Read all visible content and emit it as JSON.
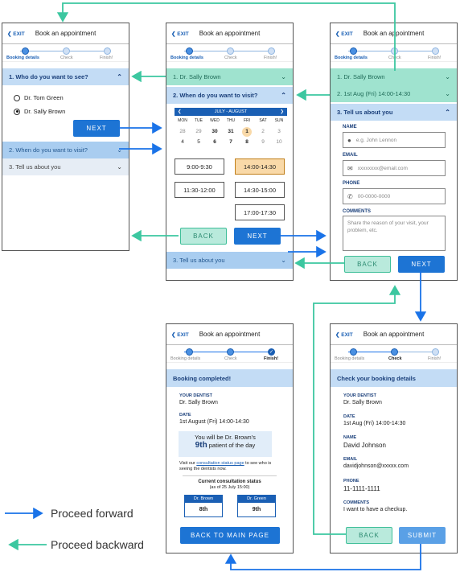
{
  "common": {
    "exit": "EXIT",
    "title": "Book an appointment",
    "steps": [
      "Booking details",
      "Check",
      "Finish!"
    ],
    "back": "BACK",
    "next": "NEXT"
  },
  "s1": {
    "q1": "1. Who do you want to see?",
    "opt1": "Dr. Tom Green",
    "opt2": "Dr. Sally Brown",
    "q2": "2. When do you want to visit?",
    "q3": "3. Tell us about you"
  },
  "s2": {
    "a1": "1. Dr. Sally Brown",
    "q2": "2. When do you want to visit?",
    "month": "JULY - AUGUST",
    "days": [
      "MON",
      "TUE",
      "WED",
      "THU",
      "FRI",
      "SAT",
      "SUN"
    ],
    "week1": [
      "28",
      "29",
      "30",
      "31",
      "1",
      "2",
      "3"
    ],
    "week2": [
      "4",
      "5",
      "6",
      "7",
      "8",
      "9",
      "10"
    ],
    "slots": [
      "9:00-9:30",
      "14:00-14:30",
      "11:30-12:00",
      "14:30-15:00",
      "17:00-17:30"
    ],
    "q3": "3. Tell us about you"
  },
  "s3": {
    "a1": "1. Dr. Sally Brown",
    "a2": "2. 1st Aug (Fri) 14:00-14:30",
    "q3": "3. Tell us about you",
    "name_lbl": "NAME",
    "name_ph": "e.g. John Lennon",
    "email_lbl": "EMAIL",
    "email_ph": "xxxxxxxx@email.com",
    "phone_lbl": "PHONE",
    "phone_ph": "00-0000-0000",
    "comments_lbl": "COMMENTS",
    "comments_ph": "Share the reason of your visit, your problem, etc."
  },
  "s4": {
    "heading": "Check your booking details",
    "dentist_lbl": "YOUR DENTIST",
    "dentist": "Dr. Sally Brown",
    "date_lbl": "DATE",
    "date": "1st Aug (Fri) 14:00-14:30",
    "name_lbl": "NAME",
    "name": "David Johnson",
    "email_lbl": "EMAIL",
    "email": "davidjohnson@xxxxx.com",
    "phone_lbl": "PHONE",
    "phone": "11-1111-1111",
    "comments_lbl": "COMMENTS",
    "comments": "I want to have a checkup.",
    "submit": "SUBMIT"
  },
  "s5": {
    "heading": "Booking completed!",
    "dentist_lbl": "YOUR DENTIST",
    "dentist": "Dr. Sally Brown",
    "date_lbl": "DATE",
    "date": "1st August (Fri) 14:00-14:30",
    "youwill": "You will be Dr. Brown's",
    "ninth": "9th",
    "patient": "patient of the day",
    "visit1": "Visit our",
    "visit_link": "consultation status page",
    "visit2": "to see who is seeing the dentists now.",
    "status_title": "Current consultation status",
    "status_sub": "(as of 25 July 15:00)",
    "dr1": "Dr. Brown",
    "dr1v": "8th",
    "dr2": "Dr. Green",
    "dr2v": "9th",
    "main_btn": "BACK TO MAIN PAGE"
  },
  "legend": {
    "forward": "Proceed forward",
    "backward": "Proceed backward"
  },
  "colors": {
    "forward": "#1a73e8",
    "backward": "#3cc7a0"
  }
}
